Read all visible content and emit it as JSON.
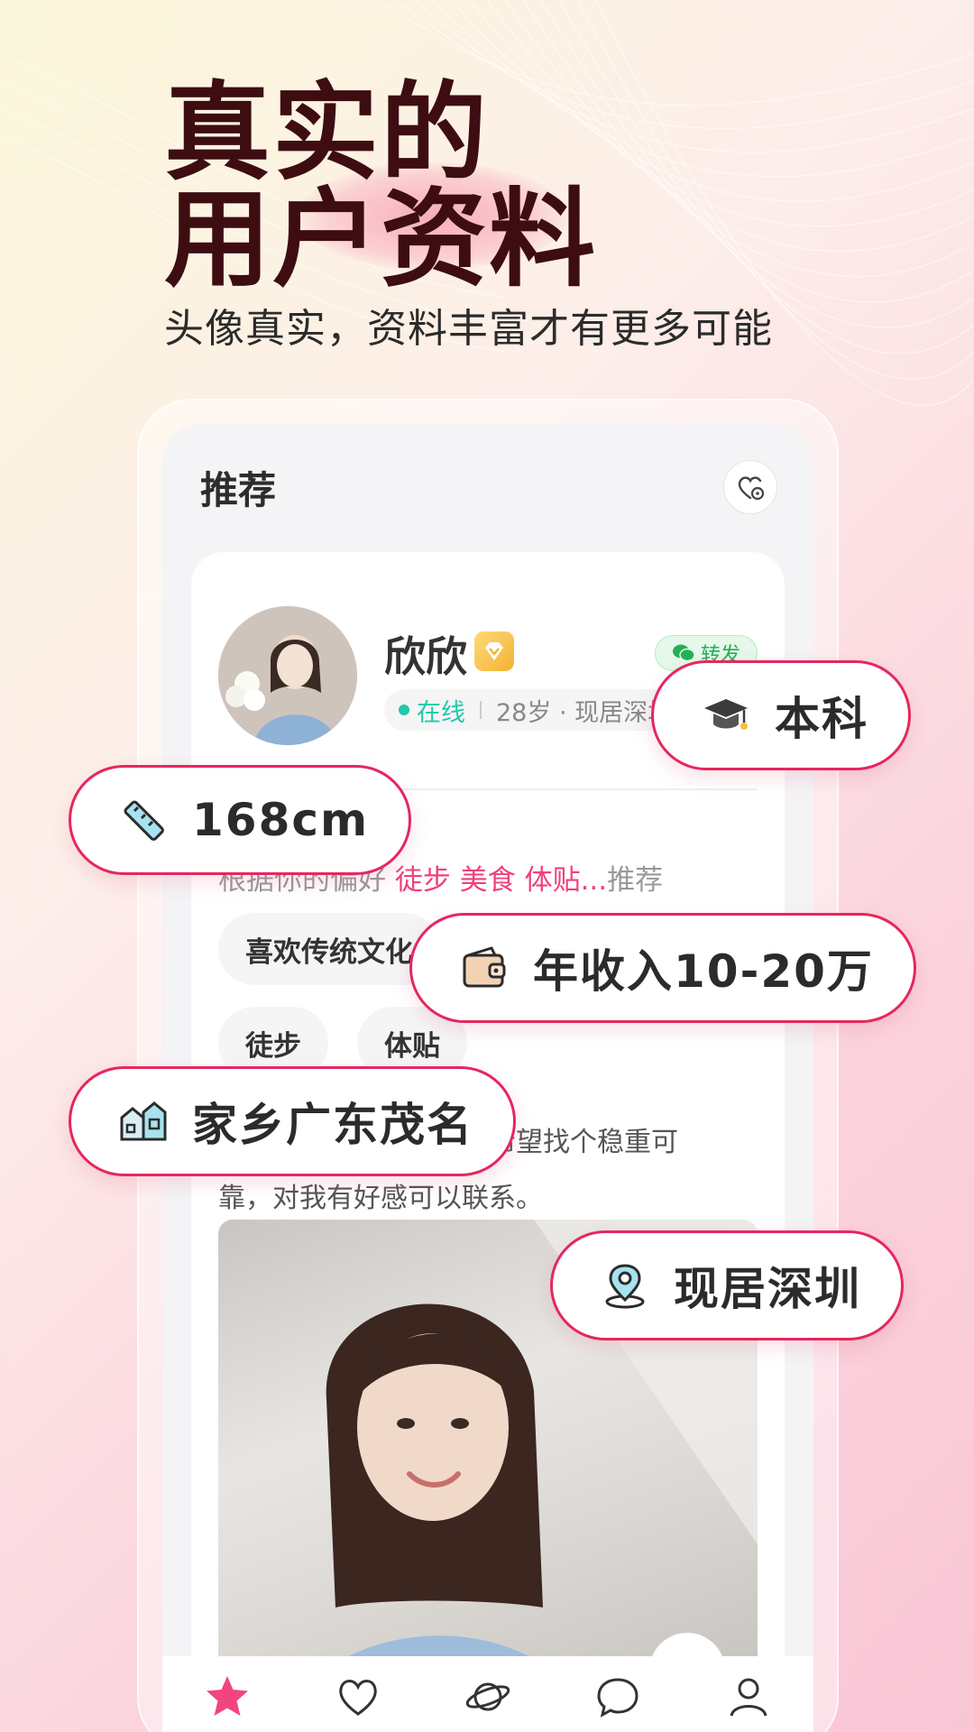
{
  "hero": {
    "title_line1": "真实的",
    "title_line2": "用户资料",
    "subtitle": "头像真实，资料丰富才有更多可能"
  },
  "screen": {
    "section_title": "推荐",
    "profile": {
      "name": "欣欣",
      "share_label": "转发",
      "online_label": "在线",
      "meta": "28岁 · 现居深圳"
    },
    "recommend_reason": {
      "prefix": "根据你的偏好",
      "keywords": "徒步 美食 体贴...",
      "suffix": "推荐"
    },
    "tags": [
      "喜欢传统文化",
      "徒步",
      "体贴"
    ],
    "bio_line1": "喜食嫩菜，性格开朗。希望找个稳重可",
    "bio_line2": "靠，对我有好感可以联系。"
  },
  "chips": {
    "education": "本科",
    "height": "168cm",
    "income": "年收入10-20万",
    "hometown": "家乡广东茂名",
    "residence": "现居深圳"
  },
  "colors": {
    "accent": "#e5275e",
    "keyword": "#f0407b",
    "online": "#21c8a9",
    "title": "#3d0d12"
  },
  "icons": {
    "education": "graduation-cap-icon",
    "height": "ruler-icon",
    "income": "wallet-icon",
    "hometown": "buildings-icon",
    "residence": "location-pin-icon"
  }
}
